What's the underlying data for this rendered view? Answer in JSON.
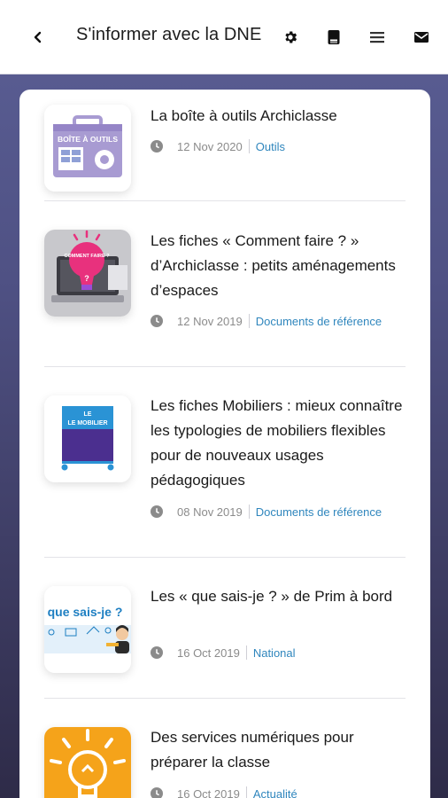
{
  "header": {
    "title": "S'informer avec la DNE",
    "icons": [
      "back-arrow-icon",
      "gear-icon",
      "book-icon",
      "menu-icon",
      "mail-icon"
    ]
  },
  "articles": [
    {
      "title": "La boîte à outils Archiclasse",
      "date": "12 Nov 2020",
      "category": "Outils",
      "thumbnail_text": "BOÎTE À OUTILS"
    },
    {
      "title": "Les fiches « Comment faire ? » d’Archiclasse : petits aménagements d’espaces",
      "date": "12 Nov 2019",
      "category": "Documents de référence",
      "thumbnail_text": "COMMENT FAIRE ?"
    },
    {
      "title": "Les fiches Mobiliers : mieux connaître les typologies de mobiliers flexibles pour de nouveaux usages pédagogiques",
      "date": "08 Nov 2019",
      "category": "Documents de référence",
      "thumbnail_text": "LE MOBILIER"
    },
    {
      "title": "Les « que sais-je ? » de Prim à bord",
      "date": "16 Oct 2019",
      "category": "National",
      "thumbnail_text": "que sais-je ?"
    },
    {
      "title": "Des services numériques pour préparer la classe",
      "date": "16 Oct 2019",
      "category": "Actualité",
      "thumbnail_text": ""
    }
  ],
  "colors": {
    "category_link": "#2f86bd",
    "date_text": "#8b8b8b",
    "background_top": "#5b5f95",
    "background_bottom": "#2e2b48"
  }
}
